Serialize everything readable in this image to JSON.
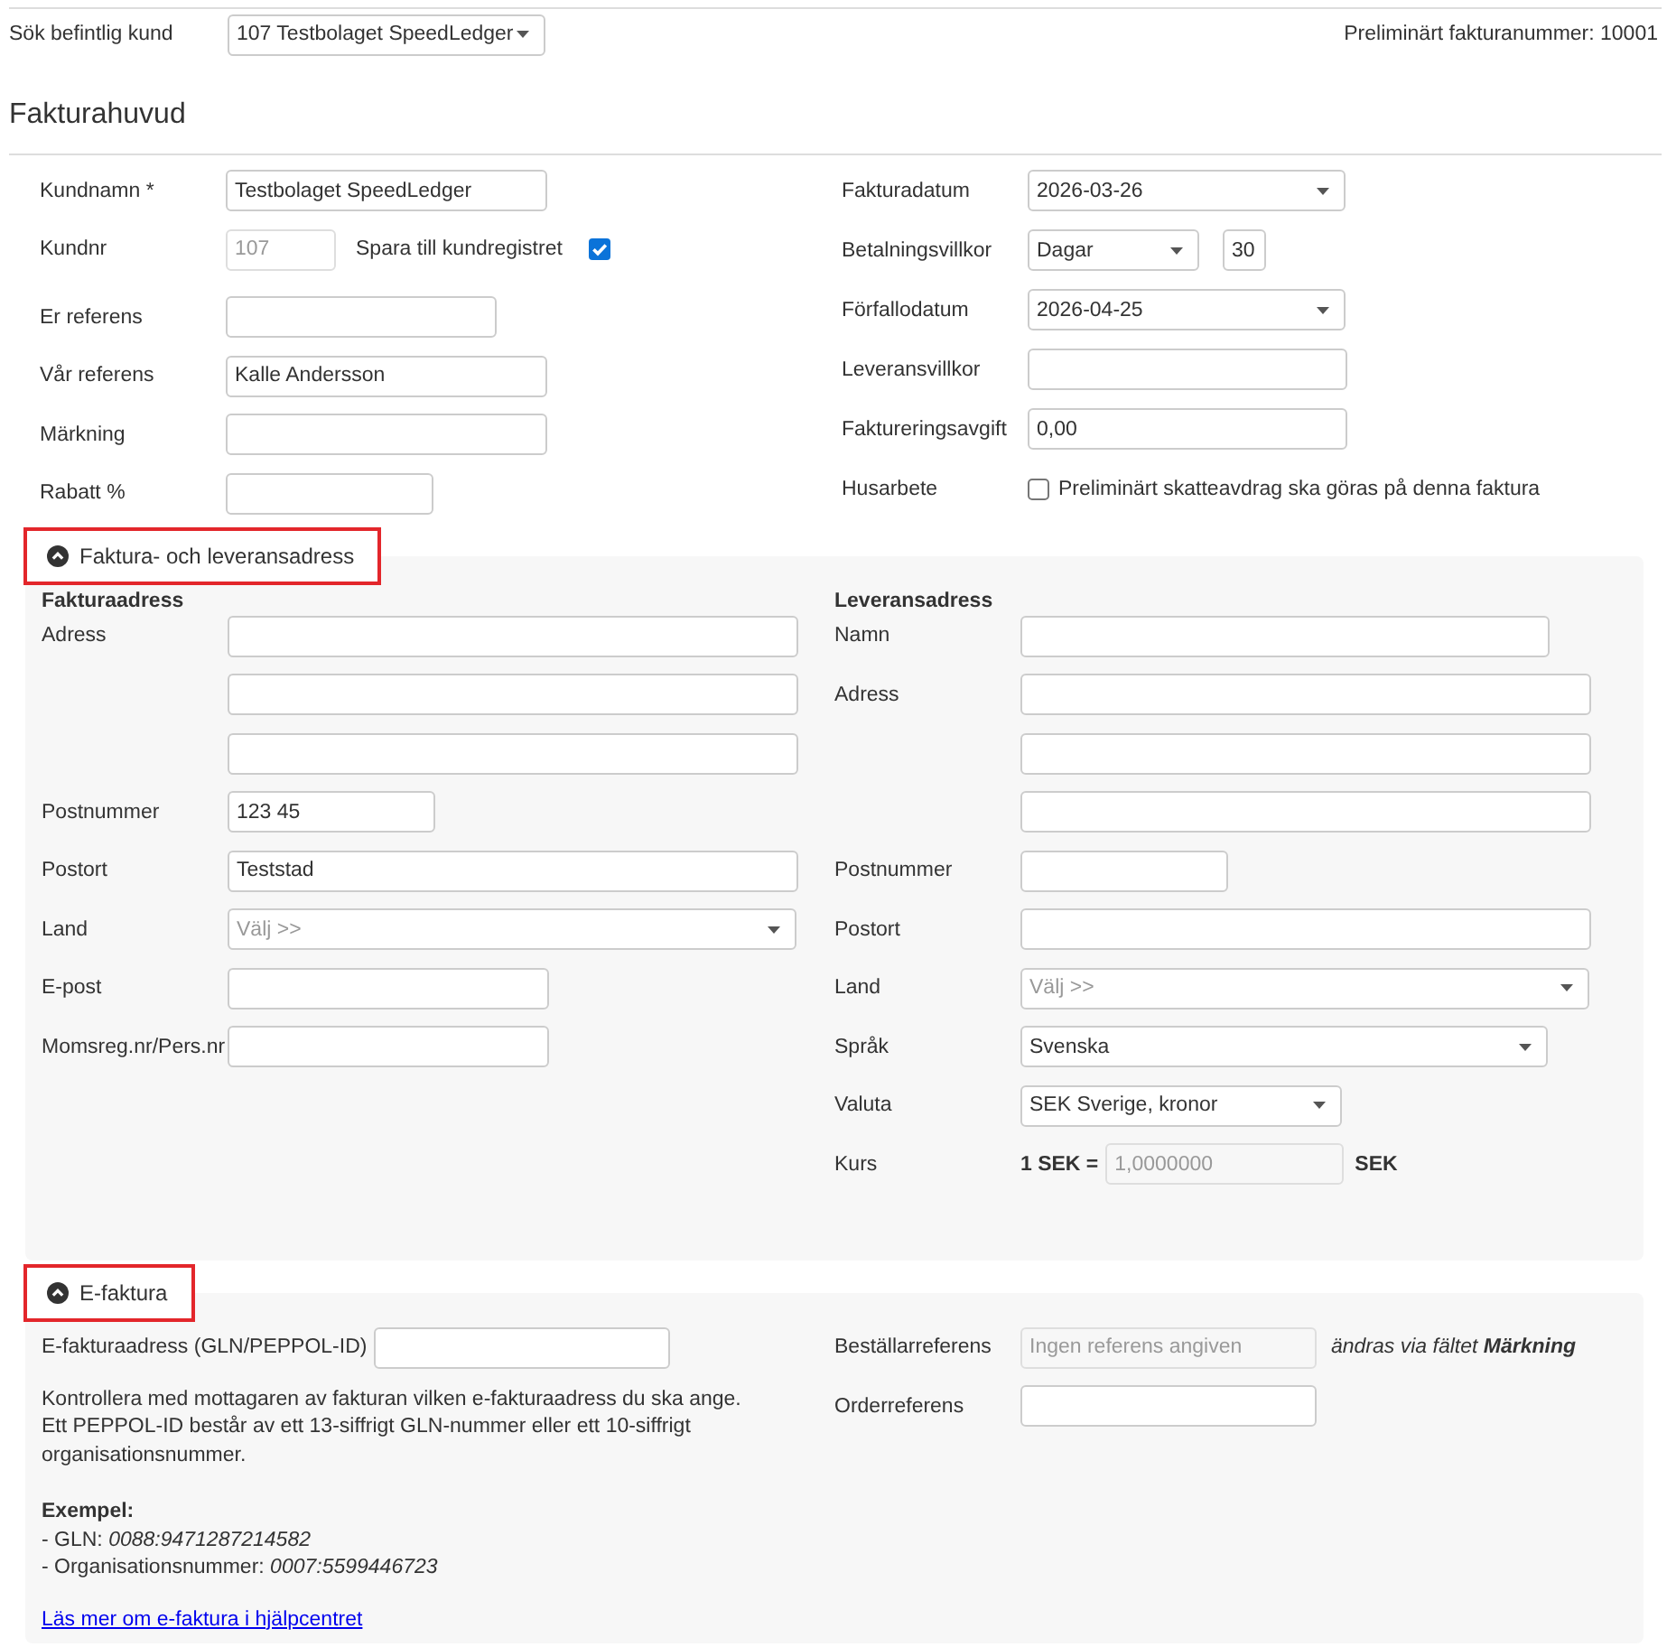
{
  "top_bar": {
    "search_label": "Sök befintlig kund",
    "customer_select": "107 Testbolaget SpeedLedger",
    "invoice_number": "Preliminärt fakturanummer: 10001"
  },
  "heading": "Fakturahuvud",
  "invoice_header": {
    "left": [
      {
        "kind": "text",
        "label": "Kundnamn *",
        "value": "Testbolaget SpeedLedger",
        "disabled": false
      },
      {
        "kind": "text_checkbox",
        "label": "Kundnr",
        "value": "107",
        "disabled": true,
        "checkbox_label": "Spara till kundregistret",
        "checked": true
      },
      {
        "kind": "text",
        "label": "Er referens",
        "disabled": false
      },
      {
        "kind": "text",
        "label": "Vår referens",
        "value": "Kalle Andersson",
        "disabled": false
      },
      {
        "kind": "text",
        "label": "Märkning",
        "disabled": false
      },
      {
        "kind": "text",
        "label": "Rabatt %",
        "disabled": false
      }
    ],
    "right": [
      {
        "kind": "select",
        "label": "Fakturadatum",
        "value": "2026-03-26"
      },
      {
        "kind": "select_number",
        "label": "Betalningsvillkor",
        "value": "Dagar",
        "number": "30"
      },
      {
        "kind": "select",
        "label": "Förfallodatum",
        "value": "2026-04-25"
      },
      {
        "kind": "text",
        "label": "Leveransvillkor"
      },
      {
        "kind": "text",
        "label": "Faktureringsavgift",
        "value": "0,00"
      },
      {
        "kind": "checkbox",
        "label": "Husarbete",
        "checkbox_label": "Preliminärt skatteavdrag ska göras på denna faktura",
        "checked": false
      }
    ]
  },
  "address_section": {
    "title": "Faktura- och leveransadress",
    "expanded": true,
    "highlighted": true,
    "invoice_address": {
      "title": "Fakturaadress",
      "fields": [
        {
          "kind": "text",
          "label": "Adress"
        },
        {
          "kind": "text"
        },
        {
          "kind": "text"
        },
        {
          "kind": "text",
          "label": "Postnummer",
          "value": "123 45"
        },
        {
          "kind": "text",
          "label": "Postort",
          "value": "Teststad"
        },
        {
          "kind": "select",
          "label": "Land",
          "placeholder": "Välj >>"
        },
        {
          "kind": "text",
          "label": "E-post"
        },
        {
          "kind": "text",
          "label": "Momsreg.nr/Pers.nr"
        }
      ]
    },
    "delivery_address": {
      "title": "Leveransadress",
      "fields": [
        {
          "kind": "text",
          "label": "Namn",
          "disabled": false
        },
        {
          "kind": "text",
          "label": "Adress",
          "disabled": false
        },
        {
          "kind": "text",
          "disabled": false
        },
        {
          "kind": "text",
          "disabled": false
        },
        {
          "kind": "text",
          "label": "Postnummer",
          "disabled": false
        },
        {
          "kind": "text",
          "label": "Postort",
          "disabled": false
        },
        {
          "kind": "select",
          "label": "Land",
          "placeholder": "Välj >>",
          "disabled": false
        },
        {
          "kind": "select",
          "label": "Språk",
          "value": "Svenska",
          "disabled": false
        },
        {
          "kind": "select",
          "label": "Valuta",
          "value": "SEK Sverige, kronor",
          "disabled": false
        },
        {
          "kind": "rate",
          "label": "Kurs",
          "prefix": "1 SEK =",
          "value": "1,0000000",
          "suffix": "SEK",
          "disabled": true
        }
      ]
    }
  },
  "efaktura_section": {
    "title": "E-faktura",
    "expanded": true,
    "highlighted": true,
    "address_field": {
      "label": "E-fakturaadress (GLN/PEPPOL-ID)"
    },
    "help_text": [
      "Kontrollera med mottagaren av fakturan vilken e-fakturaadress du ska ange.",
      "Ett PEPPOL-ID består av ett 13-siffrigt GLN-nummer eller ett 10-siffrigt organisationsnummer."
    ],
    "examples_heading": "Exempel:",
    "examples": [
      "- GLN: *0088:9471287214582*",
      "- Organisationsnummer: *0007:5599446723*"
    ],
    "link": "Läs mer om e-faktura i hjälpcentret",
    "right": [
      {
        "kind": "text",
        "label": "Beställarreferens",
        "placeholder": "Ingen referens angiven",
        "disabled": true,
        "hint": "ändras via fältet **Märkning**"
      },
      {
        "kind": "text",
        "label": "Orderreferens",
        "disabled": false
      }
    ]
  }
}
